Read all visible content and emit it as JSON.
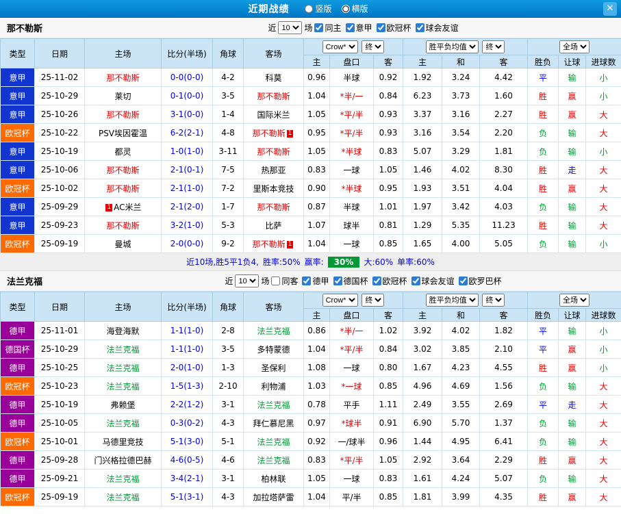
{
  "topbar": {
    "title": "近期战绩",
    "radios": [
      {
        "label": "竖版",
        "selected": false
      },
      {
        "label": "横版",
        "selected": true
      }
    ],
    "close_icon": "✕"
  },
  "colors": {
    "topbar_blue": "#0086d2",
    "league_blue": "#1235d0",
    "league_orange": "#ff6a00",
    "league_purple": "#990099",
    "focus_team_red": "#e60000",
    "focus_team_green": "#009933",
    "score_blue": "#0000ee",
    "result_win_red": "#e60000",
    "result_draw_blue": "#0000ee",
    "result_lose_green": "#009933",
    "header_bg": "#cbe5f6",
    "summary_badge_green": "#009933"
  },
  "filter_common": {
    "near": "近",
    "count": "10",
    "games": "场"
  },
  "table_header": {
    "type": "类型",
    "date": "日期",
    "home": "主场",
    "score": "比分(半场)",
    "corner": "角球",
    "away": "客场",
    "odds_source": "Crow*",
    "final_a": "终",
    "odds_cols": [
      "主",
      "盘口",
      "客"
    ],
    "euro_source": "胜平负均值",
    "final_b": "终",
    "euro_cols": [
      "主",
      "和",
      "客"
    ],
    "scope": "全场",
    "result_cols": [
      "胜负",
      "让球",
      "进球数"
    ]
  },
  "sections": [
    {
      "team": "那不勒斯",
      "filters": [
        {
          "label": "同主",
          "checked": true
        },
        {
          "label": "意甲",
          "checked": true
        },
        {
          "label": "欧冠杯",
          "checked": true
        },
        {
          "label": "球会友谊",
          "checked": true
        }
      ],
      "rows": [
        {
          "type": "意甲",
          "tc": "blue",
          "date": "25-11-02",
          "home": "那不勒斯",
          "hcls": "red",
          "hbadge": "",
          "score": "0-0(0-0)",
          "corner": "4-2",
          "away": "科莫",
          "acls": "",
          "abadge": "",
          "o": [
            "0.96",
            "半球",
            "0.92"
          ],
          "hred": false,
          "e": [
            "1.92",
            "3.24",
            "4.42"
          ],
          "r": [
            [
              "平",
              "rd"
            ],
            [
              "输",
              "rl"
            ],
            [
              "小",
              "rl"
            ]
          ]
        },
        {
          "type": "意甲",
          "tc": "blue",
          "date": "25-10-29",
          "home": "莱切",
          "hcls": "",
          "hbadge": "",
          "score": "0-1(0-0)",
          "corner": "3-5",
          "away": "那不勒斯",
          "acls": "red",
          "abadge": "",
          "o": [
            "1.04",
            "*半/一",
            "0.84"
          ],
          "hred": true,
          "e": [
            "6.23",
            "3.73",
            "1.60"
          ],
          "r": [
            [
              "胜",
              "rw"
            ],
            [
              "赢",
              "rw"
            ],
            [
              "小",
              "rl"
            ]
          ]
        },
        {
          "type": "意甲",
          "tc": "blue",
          "date": "25-10-26",
          "home": "那不勒斯",
          "hcls": "red",
          "hbadge": "",
          "score": "3-1(0-0)",
          "corner": "1-4",
          "away": "国际米兰",
          "acls": "",
          "abadge": "",
          "o": [
            "1.05",
            "*平/半",
            "0.93"
          ],
          "hred": true,
          "e": [
            "3.37",
            "3.16",
            "2.27"
          ],
          "r": [
            [
              "胜",
              "rw"
            ],
            [
              "赢",
              "rw"
            ],
            [
              "大",
              "rw"
            ]
          ]
        },
        {
          "type": "欧冠杯",
          "tc": "orange",
          "date": "25-10-22",
          "home": "PSV埃因霍温",
          "hcls": "",
          "hbadge": "",
          "score": "6-2(2-1)",
          "corner": "4-8",
          "away": "那不勒斯",
          "acls": "red",
          "abadge": "1",
          "o": [
            "0.95",
            "*平/半",
            "0.93"
          ],
          "hred": true,
          "e": [
            "3.16",
            "3.54",
            "2.20"
          ],
          "r": [
            [
              "负",
              "rl"
            ],
            [
              "输",
              "rl"
            ],
            [
              "大",
              "rw"
            ]
          ]
        },
        {
          "type": "意甲",
          "tc": "blue",
          "date": "25-10-19",
          "home": "都灵",
          "hcls": "",
          "hbadge": "",
          "score": "1-0(1-0)",
          "corner": "3-11",
          "away": "那不勒斯",
          "acls": "red",
          "abadge": "",
          "o": [
            "1.05",
            "*半球",
            "0.83"
          ],
          "hred": true,
          "e": [
            "5.07",
            "3.29",
            "1.81"
          ],
          "r": [
            [
              "负",
              "rl"
            ],
            [
              "输",
              "rl"
            ],
            [
              "小",
              "rl"
            ]
          ]
        },
        {
          "type": "意甲",
          "tc": "blue",
          "date": "25-10-06",
          "home": "那不勒斯",
          "hcls": "red",
          "hbadge": "",
          "score": "2-1(0-1)",
          "corner": "7-5",
          "away": "热那亚",
          "acls": "",
          "abadge": "",
          "o": [
            "0.83",
            "一球",
            "1.05"
          ],
          "hred": false,
          "e": [
            "1.46",
            "4.02",
            "8.30"
          ],
          "r": [
            [
              "胜",
              "rw"
            ],
            [
              "走",
              "rd"
            ],
            [
              "大",
              "rw"
            ]
          ]
        },
        {
          "type": "欧冠杯",
          "tc": "orange",
          "date": "25-10-02",
          "home": "那不勒斯",
          "hcls": "red",
          "hbadge": "",
          "score": "2-1(1-0)",
          "corner": "7-2",
          "away": "里斯本竞技",
          "acls": "",
          "abadge": "",
          "o": [
            "0.90",
            "*半球",
            "0.95"
          ],
          "hred": true,
          "e": [
            "1.93",
            "3.51",
            "4.04"
          ],
          "r": [
            [
              "胜",
              "rw"
            ],
            [
              "赢",
              "rw"
            ],
            [
              "大",
              "rw"
            ]
          ]
        },
        {
          "type": "意甲",
          "tc": "blue",
          "date": "25-09-29",
          "home": "AC米兰",
          "hcls": "",
          "hbadge": "1",
          "score": "2-1(2-0)",
          "corner": "1-7",
          "away": "那不勒斯",
          "acls": "red",
          "abadge": "",
          "o": [
            "0.87",
            "半球",
            "1.01"
          ],
          "hred": false,
          "e": [
            "1.97",
            "3.42",
            "4.03"
          ],
          "r": [
            [
              "负",
              "rl"
            ],
            [
              "输",
              "rl"
            ],
            [
              "大",
              "rw"
            ]
          ]
        },
        {
          "type": "意甲",
          "tc": "blue",
          "date": "25-09-23",
          "home": "那不勒斯",
          "hcls": "red",
          "hbadge": "",
          "score": "3-2(1-0)",
          "corner": "5-3",
          "away": "比萨",
          "acls": "",
          "abadge": "",
          "o": [
            "1.07",
            "球半",
            "0.81"
          ],
          "hred": false,
          "e": [
            "1.29",
            "5.35",
            "11.23"
          ],
          "r": [
            [
              "胜",
              "rw"
            ],
            [
              "输",
              "rl"
            ],
            [
              "大",
              "rw"
            ]
          ]
        },
        {
          "type": "欧冠杯",
          "tc": "orange",
          "date": "25-09-19",
          "home": "曼城",
          "hcls": "",
          "hbadge": "",
          "score": "2-0(0-0)",
          "corner": "9-2",
          "away": "那不勒斯",
          "acls": "red",
          "abadge": "1",
          "o": [
            "1.04",
            "一球",
            "0.85"
          ],
          "hred": false,
          "e": [
            "1.65",
            "4.00",
            "5.05"
          ],
          "r": [
            [
              "负",
              "rl"
            ],
            [
              "输",
              "rl"
            ],
            [
              "小",
              "rl"
            ]
          ]
        }
      ],
      "summary": {
        "games": "近10场,胜5平1负4,",
        "win_rate": "胜率:50%",
        "cover_label": "赢率:",
        "cover_value": "30%",
        "over": "大:60%",
        "single": "单率:60%"
      }
    },
    {
      "team": "法兰克福",
      "filters": [
        {
          "label": "同客",
          "checked": false
        },
        {
          "label": "德甲",
          "checked": true
        },
        {
          "label": "德国杯",
          "checked": true
        },
        {
          "label": "欧冠杯",
          "checked": true
        },
        {
          "label": "球会友谊",
          "checked": true
        },
        {
          "label": "欧罗巴杯",
          "checked": true
        }
      ],
      "rows": [
        {
          "type": "德甲",
          "tc": "purple",
          "date": "25-11-01",
          "home": "海登海默",
          "hcls": "",
          "hbadge": "",
          "score": "1-1(1-0)",
          "corner": "2-8",
          "away": "法兰克福",
          "acls": "green",
          "abadge": "",
          "o": [
            "0.86",
            "*半/一",
            "1.02"
          ],
          "hred": true,
          "e": [
            "3.92",
            "4.02",
            "1.82"
          ],
          "r": [
            [
              "平",
              "rd"
            ],
            [
              "输",
              "rl"
            ],
            [
              "小",
              "rl"
            ]
          ]
        },
        {
          "type": "德国杯",
          "tc": "purple",
          "date": "25-10-29",
          "home": "法兰克福",
          "hcls": "green",
          "hbadge": "",
          "score": "1-1(1-0)",
          "corner": "3-5",
          "away": "多特蒙德",
          "acls": "",
          "abadge": "",
          "o": [
            "1.04",
            "*平/半",
            "0.84"
          ],
          "hred": true,
          "e": [
            "3.02",
            "3.85",
            "2.10"
          ],
          "r": [
            [
              "平",
              "rd"
            ],
            [
              "赢",
              "rw"
            ],
            [
              "小",
              "rl"
            ]
          ]
        },
        {
          "type": "德甲",
          "tc": "purple",
          "date": "25-10-25",
          "home": "法兰克福",
          "hcls": "green",
          "hbadge": "",
          "score": "2-0(1-0)",
          "corner": "1-3",
          "away": "圣保利",
          "acls": "",
          "abadge": "",
          "o": [
            "1.08",
            "一球",
            "0.80"
          ],
          "hred": false,
          "e": [
            "1.67",
            "4.23",
            "4.55"
          ],
          "r": [
            [
              "胜",
              "rw"
            ],
            [
              "赢",
              "rw"
            ],
            [
              "小",
              "rl"
            ]
          ]
        },
        {
          "type": "欧冠杯",
          "tc": "orange",
          "date": "25-10-23",
          "home": "法兰克福",
          "hcls": "green",
          "hbadge": "",
          "score": "1-5(1-3)",
          "corner": "2-10",
          "away": "利物浦",
          "acls": "",
          "abadge": "",
          "o": [
            "1.03",
            "*一球",
            "0.85"
          ],
          "hred": true,
          "e": [
            "4.96",
            "4.69",
            "1.56"
          ],
          "r": [
            [
              "负",
              "rl"
            ],
            [
              "输",
              "rl"
            ],
            [
              "大",
              "rw"
            ]
          ]
        },
        {
          "type": "德甲",
          "tc": "purple",
          "date": "25-10-19",
          "home": "弗赖堡",
          "hcls": "",
          "hbadge": "",
          "score": "2-2(1-2)",
          "corner": "3-1",
          "away": "法兰克福",
          "acls": "green",
          "abadge": "",
          "o": [
            "0.78",
            "平手",
            "1.11"
          ],
          "hred": false,
          "e": [
            "2.49",
            "3.55",
            "2.69"
          ],
          "r": [
            [
              "平",
              "rd"
            ],
            [
              "走",
              "rd"
            ],
            [
              "大",
              "rw"
            ]
          ]
        },
        {
          "type": "德甲",
          "tc": "purple",
          "date": "25-10-05",
          "home": "法兰克福",
          "hcls": "green",
          "hbadge": "",
          "score": "0-3(0-2)",
          "corner": "4-3",
          "away": "拜仁慕尼黑",
          "acls": "",
          "abadge": "",
          "o": [
            "0.97",
            "*球半",
            "0.91"
          ],
          "hred": true,
          "e": [
            "6.90",
            "5.70",
            "1.37"
          ],
          "r": [
            [
              "负",
              "rl"
            ],
            [
              "输",
              "rl"
            ],
            [
              "大",
              "rw"
            ]
          ]
        },
        {
          "type": "欧冠杯",
          "tc": "orange",
          "date": "25-10-01",
          "home": "马德里竞技",
          "hcls": "",
          "hbadge": "",
          "score": "5-1(3-0)",
          "corner": "5-1",
          "away": "法兰克福",
          "acls": "green",
          "abadge": "",
          "o": [
            "0.92",
            "一/球半",
            "0.96"
          ],
          "hred": false,
          "e": [
            "1.44",
            "4.95",
            "6.41"
          ],
          "r": [
            [
              "负",
              "rl"
            ],
            [
              "输",
              "rl"
            ],
            [
              "大",
              "rw"
            ]
          ]
        },
        {
          "type": "德甲",
          "tc": "purple",
          "date": "25-09-28",
          "home": "门兴格拉德巴赫",
          "hcls": "",
          "hbadge": "",
          "score": "4-6(0-5)",
          "corner": "4-6",
          "away": "法兰克福",
          "acls": "green",
          "abadge": "",
          "o": [
            "0.83",
            "*平/半",
            "1.05"
          ],
          "hred": true,
          "e": [
            "2.92",
            "3.64",
            "2.29"
          ],
          "r": [
            [
              "胜",
              "rw"
            ],
            [
              "赢",
              "rw"
            ],
            [
              "大",
              "rw"
            ]
          ]
        },
        {
          "type": "德甲",
          "tc": "purple",
          "date": "25-09-21",
          "home": "法兰克福",
          "hcls": "green",
          "hbadge": "",
          "score": "3-4(2-1)",
          "corner": "3-1",
          "away": "柏林联",
          "acls": "",
          "abadge": "",
          "o": [
            "1.05",
            "一球",
            "0.83"
          ],
          "hred": false,
          "e": [
            "1.61",
            "4.24",
            "5.07"
          ],
          "r": [
            [
              "负",
              "rl"
            ],
            [
              "输",
              "rl"
            ],
            [
              "大",
              "rw"
            ]
          ]
        },
        {
          "type": "欧冠杯",
          "tc": "orange",
          "date": "25-09-19",
          "home": "法兰克福",
          "hcls": "green",
          "hbadge": "",
          "score": "5-1(3-1)",
          "corner": "4-3",
          "away": "加拉塔萨雷",
          "acls": "",
          "abadge": "",
          "o": [
            "1.04",
            "平/半",
            "0.85"
          ],
          "hred": false,
          "e": [
            "1.81",
            "3.99",
            "4.35"
          ],
          "r": [
            [
              "胜",
              "rw"
            ],
            [
              "赢",
              "rw"
            ],
            [
              "大",
              "rw"
            ]
          ]
        }
      ]
    }
  ]
}
